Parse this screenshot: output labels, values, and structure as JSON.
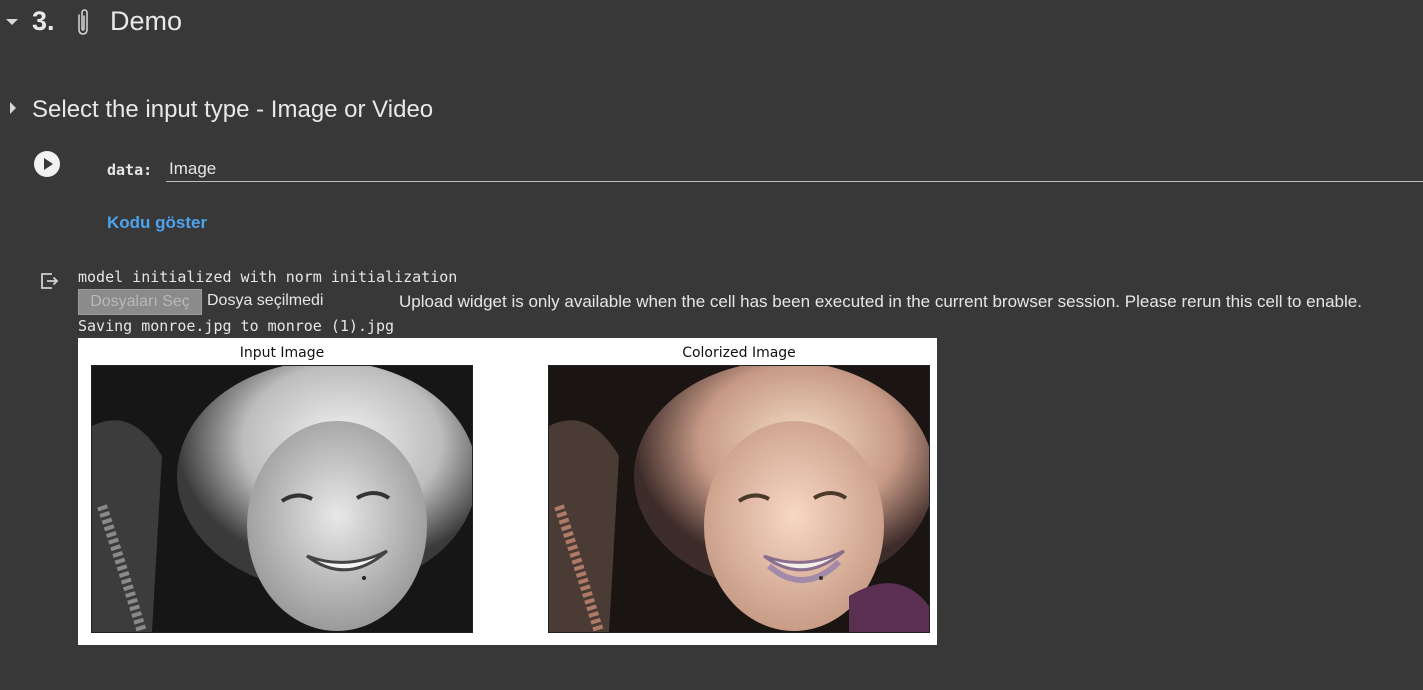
{
  "section": {
    "number": "3.",
    "icon": "paperclip-icon",
    "title": "Demo"
  },
  "subsection": {
    "title": "Select the input type - Image or Video"
  },
  "form": {
    "field_label": "data:",
    "field_value": "Image",
    "show_code_link": "Kodu göster"
  },
  "output": {
    "log_line_1": "model initialized with norm initialization",
    "file_button_label": "Dosyaları Seç",
    "file_status": "Dosya seçilmedi",
    "upload_notice": "Upload widget is only available when the cell has been executed in the current browser session. Please rerun this cell to enable.",
    "log_line_2": "Saving monroe.jpg to monroe (1).jpg"
  },
  "figure": {
    "input_title": "Input Image",
    "output_title": "Colorized Image"
  },
  "colors": {
    "background": "#383838",
    "link": "#4ea3ee",
    "text": "#e8e8e8"
  }
}
